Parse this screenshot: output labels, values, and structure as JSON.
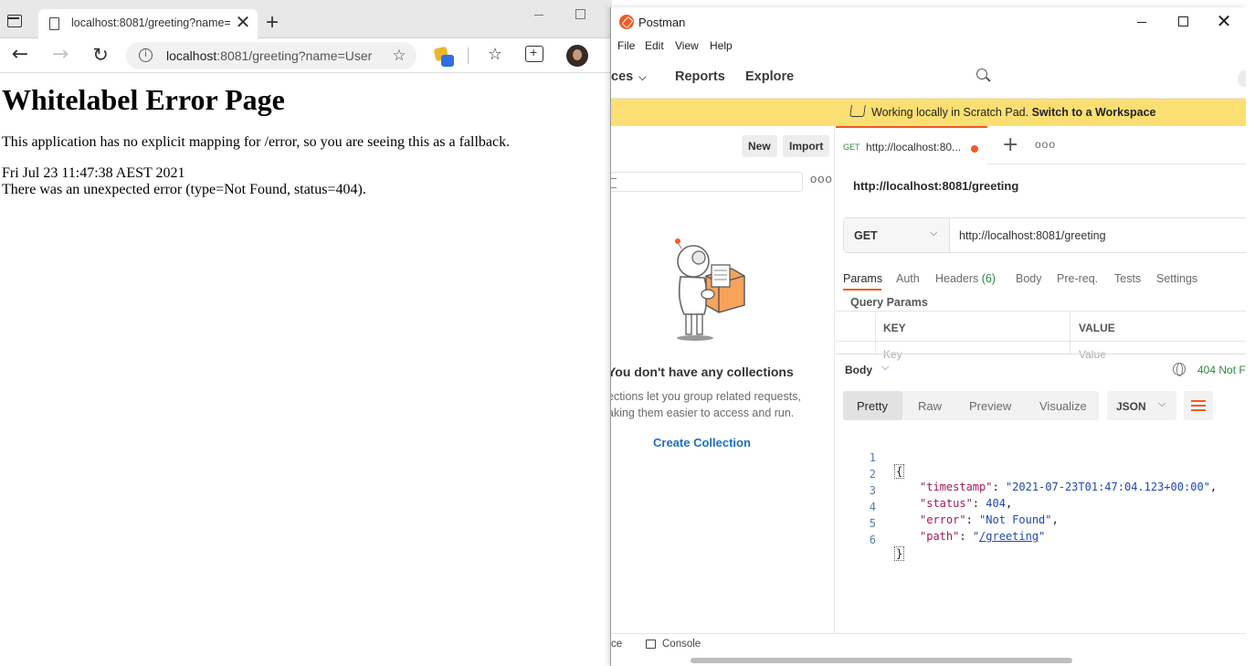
{
  "edge": {
    "tab_title": "localhost:8081/greeting?name=U",
    "close_glyph": "✕",
    "new_tab_glyph": "+",
    "url_host": "localhost",
    "url_rest": ":8081/greeting?name=User",
    "back_glyph": "←",
    "forward_glyph": "→",
    "refresh_glyph": "↻",
    "favorites_glyph": "☆",
    "add_favorite_glyph": "☆",
    "info_glyph": "i"
  },
  "page": {
    "heading": "Whitelabel Error Page",
    "message": "This application has no explicit mapping for /error, so you are seeing this as a fallback.",
    "timestamp": "Fri Jul 23 11:47:38 AEST 2021",
    "error_line": "There was an unexpected error (type=Not Found, status=404)."
  },
  "postman": {
    "window_title": "Postman",
    "close_glyph": "✕",
    "menu": [
      "File",
      "Edit",
      "View",
      "Help"
    ],
    "nav": {
      "workspaces_partial": "ces",
      "reports": "Reports",
      "explore": "Explore",
      "chevron": "⌵"
    },
    "banner": {
      "text": "Working locally in Scratch Pad.",
      "link": "Switch to a Workspace"
    },
    "sidebar": {
      "new_button": "New",
      "import_button": "Import",
      "more_glyph": "ooo",
      "empty_title": "You don't have any collections",
      "empty_desc": "ections let you group related requests, aking them easier to access and run.",
      "create_link": "Create Collection"
    },
    "request_tab": {
      "method": "GET",
      "url": "http://localhost:80...",
      "plus_glyph": "+",
      "more_glyph": "ooo"
    },
    "request": {
      "name": "http://localhost:8081/greeting",
      "method": "GET",
      "method_chevron": "⌵",
      "url": "http://localhost:8081/greeting"
    },
    "option_tabs": {
      "params": "Params",
      "auth": "Auth",
      "headers": "Headers",
      "headers_count": "(6)",
      "body": "Body",
      "prereq": "Pre-req.",
      "tests": "Tests",
      "settings": "Settings"
    },
    "query_params": {
      "title": "Query Params",
      "key_header": "KEY",
      "value_header": "VALUE",
      "key_placeholder": "Key",
      "value_placeholder": "Value"
    },
    "response": {
      "body_label": "Body",
      "body_chevron": "⌵",
      "status": "404 Not F",
      "view_tabs": [
        "Pretty",
        "Raw",
        "Preview",
        "Visualize"
      ],
      "format": "JSON",
      "format_chevron": "⌵"
    },
    "json_lines": {
      "n1": "1",
      "n2": "2",
      "n3": "3",
      "n4": "4",
      "n5": "5",
      "n6": "6",
      "open_brace": "{",
      "close_brace": "}",
      "timestamp_key": "\"timestamp\"",
      "timestamp_val": "\"2021-07-23T01:47:04.123+00:00\"",
      "status_key": "\"status\"",
      "status_val": "404",
      "error_key": "\"error\"",
      "error_val": "\"Not Found\"",
      "path_key": "\"path\"",
      "path_q1": "\"",
      "path_val": "/greeting",
      "path_q2": "\""
    },
    "footer": {
      "partial_left": "ce",
      "console": "Console"
    }
  },
  "colors": {
    "postman_orange": "#ef5b25",
    "banner_yellow": "#fcdf72",
    "link_blue": "#1d6ec0",
    "status_green": "#2a8a3a"
  }
}
